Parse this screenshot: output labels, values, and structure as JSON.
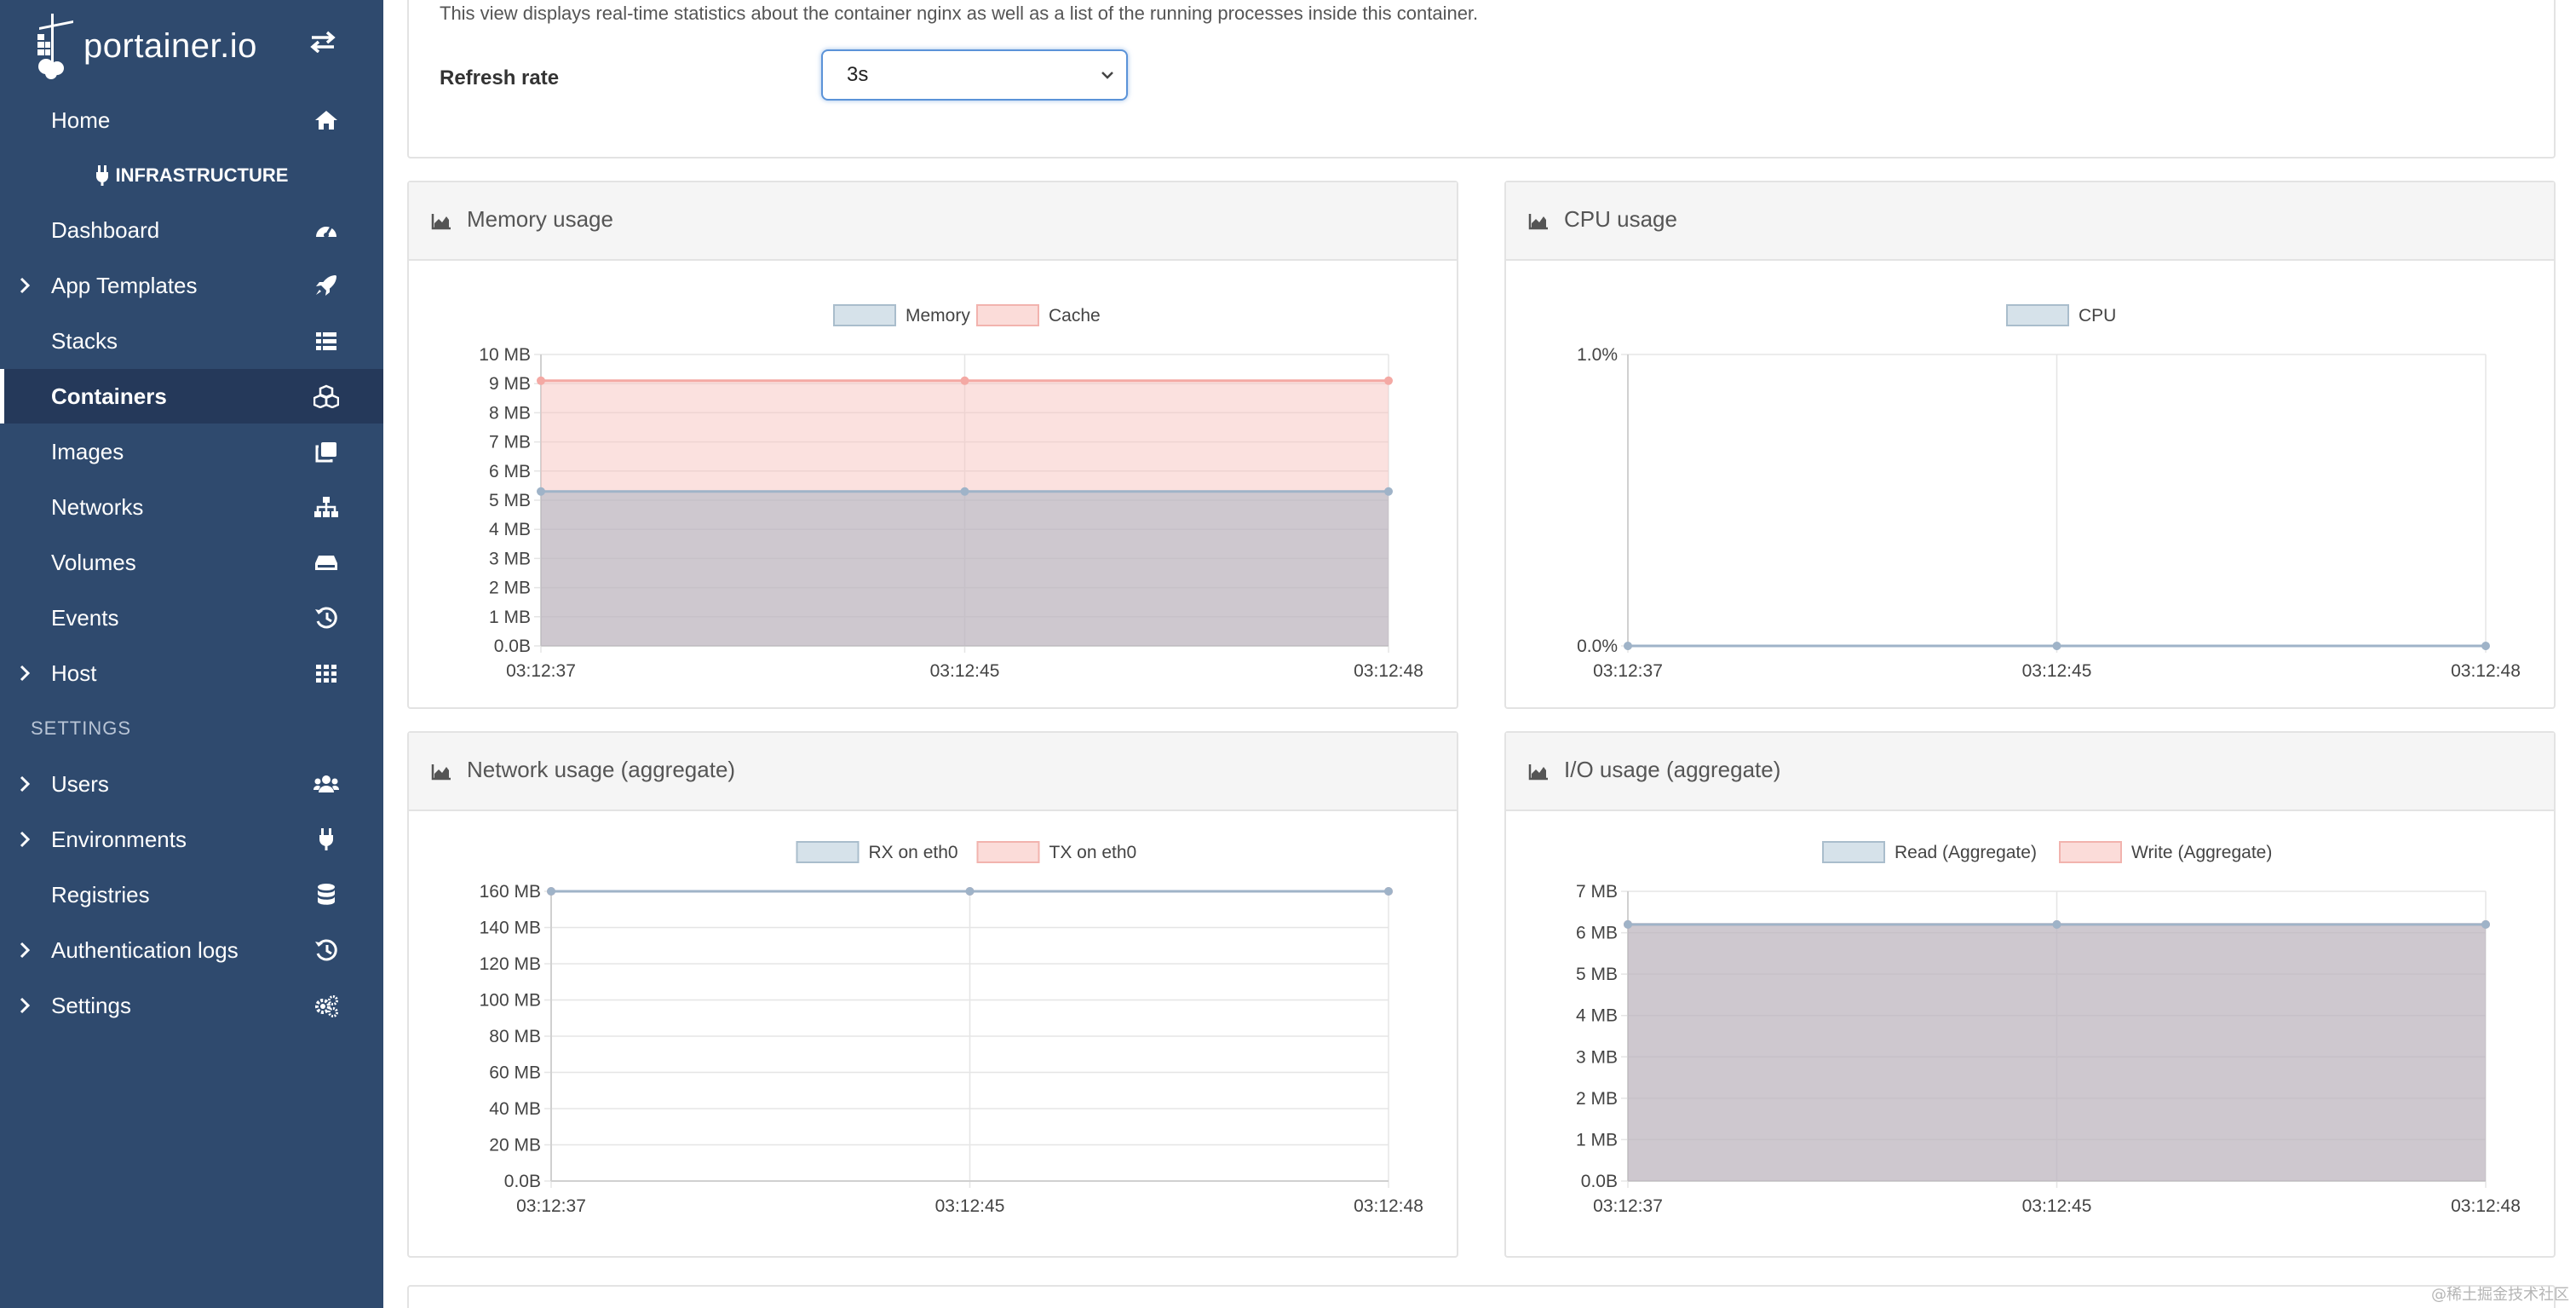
{
  "sidebar": {
    "logo_text": "portainer.io",
    "items": [
      {
        "label": "Home",
        "icon": "home-icon",
        "chevron": false
      },
      {
        "label": "Dashboard",
        "icon": "dashboard-icon",
        "chevron": false
      },
      {
        "label": "App Templates",
        "icon": "rocket-icon",
        "chevron": true
      },
      {
        "label": "Stacks",
        "icon": "list-icon",
        "chevron": false
      },
      {
        "label": "Containers",
        "icon": "cubes-icon",
        "chevron": false,
        "active": true
      },
      {
        "label": "Images",
        "icon": "clone-icon",
        "chevron": false
      },
      {
        "label": "Networks",
        "icon": "sitemap-icon",
        "chevron": false
      },
      {
        "label": "Volumes",
        "icon": "hdd-icon",
        "chevron": false
      },
      {
        "label": "Events",
        "icon": "history-icon",
        "chevron": false
      },
      {
        "label": "Host",
        "icon": "grid-icon",
        "chevron": true
      },
      {
        "label": "Users",
        "icon": "users-icon",
        "chevron": true
      },
      {
        "label": "Environments",
        "icon": "plug-icon",
        "chevron": true
      },
      {
        "label": "Registries",
        "icon": "database-icon",
        "chevron": false
      },
      {
        "label": "Authentication logs",
        "icon": "history-icon",
        "chevron": true
      },
      {
        "label": "Settings",
        "icon": "cogs-icon",
        "chevron": true
      }
    ],
    "section_infrastructure": "INFRASTRUCTURE",
    "section_settings": "SETTINGS"
  },
  "stats": {
    "description": "This view displays real-time statistics about the container nginx as well as a list of the running processes inside this container.",
    "refresh_label": "Refresh rate",
    "refresh_value": "3s"
  },
  "colors": {
    "sidebar_bg": "#2f4a6e",
    "series_blue_fill": "#cfdde5",
    "series_pink_fill": "#f9ddda",
    "accent": "#5b93d8"
  },
  "chart_data": [
    {
      "title": "Memory usage",
      "type": "area",
      "x": [
        "03:12:37",
        "03:12:45",
        "03:12:48"
      ],
      "yticks": [
        "10 MB",
        "9 MB",
        "8 MB",
        "7 MB",
        "6 MB",
        "5 MB",
        "4 MB",
        "3 MB",
        "2 MB",
        "1 MB",
        "0.0B"
      ],
      "ylim": [
        0,
        10
      ],
      "series": [
        {
          "name": "Memory",
          "values": [
            5.3,
            5.3,
            5.3
          ]
        },
        {
          "name": "Cache",
          "values": [
            9.1,
            9.1,
            9.1
          ]
        }
      ],
      "grid": true,
      "legend": "top"
    },
    {
      "title": "CPU usage",
      "type": "line",
      "x": [
        "03:12:37",
        "03:12:45",
        "03:12:48"
      ],
      "yticks": [
        "1.0%",
        "0.0%"
      ],
      "ylim": [
        0,
        1
      ],
      "series": [
        {
          "name": "CPU",
          "values": [
            0,
            0,
            0
          ]
        }
      ],
      "grid": true,
      "legend": "top"
    },
    {
      "title": "Network usage (aggregate)",
      "type": "line",
      "x": [
        "03:12:37",
        "03:12:45",
        "03:12:48"
      ],
      "yticks": [
        "160 MB",
        "140 MB",
        "120 MB",
        "100 MB",
        "80 MB",
        "60 MB",
        "40 MB",
        "20 MB",
        "0.0B"
      ],
      "ylim": [
        0,
        160
      ],
      "series": [
        {
          "name": "RX on eth0",
          "values": [
            160,
            160,
            160
          ]
        },
        {
          "name": "TX on eth0",
          "values": [
            160,
            160,
            160
          ]
        }
      ],
      "grid": true,
      "legend": "top"
    },
    {
      "title": "I/O usage (aggregate)",
      "type": "area",
      "x": [
        "03:12:37",
        "03:12:45",
        "03:12:48"
      ],
      "yticks": [
        "7 MB",
        "6 MB",
        "5 MB",
        "4 MB",
        "3 MB",
        "2 MB",
        "1 MB",
        "0.0B"
      ],
      "ylim": [
        0,
        7
      ],
      "series": [
        {
          "name": "Read (Aggregate)",
          "values": [
            6.2,
            6.2,
            6.2
          ]
        },
        {
          "name": "Write (Aggregate)",
          "values": [
            6.2,
            6.2,
            6.2
          ]
        }
      ],
      "grid": true,
      "legend": "top"
    }
  ],
  "watermark": "@稀土掘金技术社区"
}
